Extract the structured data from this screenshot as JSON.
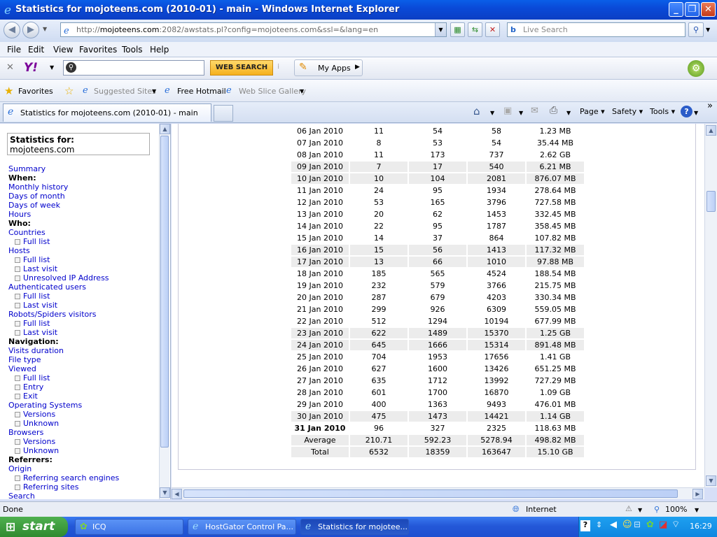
{
  "window": {
    "title": "Statistics for mojoteens.com (2010-01) - main - Windows Internet Explorer"
  },
  "address": {
    "url_prefix": "http://",
    "url_host": "mojoteens.com",
    "url_rest": ":2082/awstats.pl?config=mojoteens.com&ssl=&lang=en"
  },
  "search": {
    "placeholder": "Live Search"
  },
  "menu": [
    "File",
    "Edit",
    "View",
    "Favorites",
    "Tools",
    "Help"
  ],
  "yahoo": {
    "logo": "Y!",
    "web_search": "WEB SEARCH",
    "my_apps": "My Apps"
  },
  "favorites": {
    "favorites_label": "Favorites",
    "suggested": "Suggested Sites",
    "hotmail": "Free Hotmail",
    "webslice": "Web Slice Gallery"
  },
  "tab": {
    "label": "Statistics for mojoteens.com (2010-01) - main"
  },
  "commands": {
    "page": "Page",
    "safety": "Safety",
    "tools": "Tools"
  },
  "sidebar": {
    "stats_for": "Statistics for:",
    "site": "mojoteens.com",
    "items": [
      {
        "t": "Summary",
        "k": "lnk"
      },
      {
        "t": "When:",
        "k": "hd"
      },
      {
        "t": "Monthly history",
        "k": "lnk"
      },
      {
        "t": "Days of month",
        "k": "lnk"
      },
      {
        "t": "Days of week",
        "k": "lnk"
      },
      {
        "t": "Hours",
        "k": "lnk"
      },
      {
        "t": "Who:",
        "k": "hd"
      },
      {
        "t": "Countries",
        "k": "lnk"
      },
      {
        "t": "Full list",
        "k": "sub"
      },
      {
        "t": "Hosts",
        "k": "lnk"
      },
      {
        "t": "Full list",
        "k": "sub"
      },
      {
        "t": "Last visit",
        "k": "sub"
      },
      {
        "t": "Unresolved IP Address",
        "k": "sub"
      },
      {
        "t": "Authenticated users",
        "k": "lnk"
      },
      {
        "t": "Full list",
        "k": "sub"
      },
      {
        "t": "Last visit",
        "k": "sub"
      },
      {
        "t": "Robots/Spiders visitors",
        "k": "lnk"
      },
      {
        "t": "Full list",
        "k": "sub"
      },
      {
        "t": "Last visit",
        "k": "sub"
      },
      {
        "t": "Navigation:",
        "k": "hd"
      },
      {
        "t": "Visits duration",
        "k": "lnk"
      },
      {
        "t": "File type",
        "k": "lnk"
      },
      {
        "t": "Viewed",
        "k": "lnk"
      },
      {
        "t": "Full list",
        "k": "sub"
      },
      {
        "t": "Entry",
        "k": "sub"
      },
      {
        "t": "Exit",
        "k": "sub"
      },
      {
        "t": "Operating Systems",
        "k": "lnk"
      },
      {
        "t": "Versions",
        "k": "sub"
      },
      {
        "t": "Unknown",
        "k": "sub"
      },
      {
        "t": "Browsers",
        "k": "lnk"
      },
      {
        "t": "Versions",
        "k": "sub"
      },
      {
        "t": "Unknown",
        "k": "sub"
      },
      {
        "t": "Referrers:",
        "k": "hd"
      },
      {
        "t": "Origin",
        "k": "lnk"
      },
      {
        "t": "Referring search engines",
        "k": "sub"
      },
      {
        "t": "Referring sites",
        "k": "sub"
      },
      {
        "t": "Search",
        "k": "lnk"
      }
    ]
  },
  "stats_rows": [
    [
      "06 Jan 2010",
      "11",
      "54",
      "58",
      "1.23 MB"
    ],
    [
      "07 Jan 2010",
      "8",
      "53",
      "54",
      "35.44 MB"
    ],
    [
      "08 Jan 2010",
      "11",
      "173",
      "737",
      "2.62 GB"
    ],
    [
      "09 Jan 2010",
      "7",
      "17",
      "540",
      "6.21 MB"
    ],
    [
      "10 Jan 2010",
      "10",
      "104",
      "2081",
      "876.07 MB"
    ],
    [
      "11 Jan 2010",
      "24",
      "95",
      "1934",
      "278.64 MB"
    ],
    [
      "12 Jan 2010",
      "53",
      "165",
      "3796",
      "727.58 MB"
    ],
    [
      "13 Jan 2010",
      "20",
      "62",
      "1453",
      "332.45 MB"
    ],
    [
      "14 Jan 2010",
      "22",
      "95",
      "1787",
      "358.45 MB"
    ],
    [
      "15 Jan 2010",
      "14",
      "37",
      "864",
      "107.82 MB"
    ],
    [
      "16 Jan 2010",
      "15",
      "56",
      "1413",
      "117.32 MB"
    ],
    [
      "17 Jan 2010",
      "13",
      "66",
      "1010",
      "97.88 MB"
    ],
    [
      "18 Jan 2010",
      "185",
      "565",
      "4524",
      "188.54 MB"
    ],
    [
      "19 Jan 2010",
      "232",
      "579",
      "3766",
      "215.75 MB"
    ],
    [
      "20 Jan 2010",
      "287",
      "679",
      "4203",
      "330.34 MB"
    ],
    [
      "21 Jan 2010",
      "299",
      "926",
      "6309",
      "559.05 MB"
    ],
    [
      "22 Jan 2010",
      "512",
      "1294",
      "10194",
      "677.99 MB"
    ],
    [
      "23 Jan 2010",
      "622",
      "1489",
      "15370",
      "1.25 GB"
    ],
    [
      "24 Jan 2010",
      "645",
      "1666",
      "15314",
      "891.48 MB"
    ],
    [
      "25 Jan 2010",
      "704",
      "1953",
      "17656",
      "1.41 GB"
    ],
    [
      "26 Jan 2010",
      "627",
      "1600",
      "13426",
      "651.25 MB"
    ],
    [
      "27 Jan 2010",
      "635",
      "1712",
      "13992",
      "727.29 MB"
    ],
    [
      "28 Jan 2010",
      "601",
      "1700",
      "16870",
      "1.09 GB"
    ],
    [
      "29 Jan 2010",
      "400",
      "1363",
      "9493",
      "476.01 MB"
    ],
    [
      "30 Jan 2010",
      "475",
      "1473",
      "14421",
      "1.14 GB"
    ],
    [
      "31 Jan 2010",
      "96",
      "327",
      "2325",
      "118.63 MB"
    ]
  ],
  "stats_shaded": [
    false,
    false,
    false,
    true,
    true,
    false,
    false,
    false,
    false,
    false,
    true,
    true,
    false,
    false,
    false,
    false,
    false,
    true,
    true,
    false,
    false,
    false,
    false,
    false,
    true,
    false
  ],
  "stats_bold_index": 25,
  "stats_summary": [
    [
      "Average",
      "210.71",
      "592.23",
      "5278.94",
      "498.82 MB"
    ],
    [
      "Total",
      "6532",
      "18359",
      "163647",
      "15.10 GB"
    ]
  ],
  "status": {
    "left": "Done",
    "zone": "Internet",
    "zoom": "100%"
  },
  "taskbar": {
    "start": "start",
    "tasks": [
      "ICQ",
      "HostGator Control Pa...",
      "Statistics for mojotee..."
    ],
    "clock": "16:29"
  }
}
